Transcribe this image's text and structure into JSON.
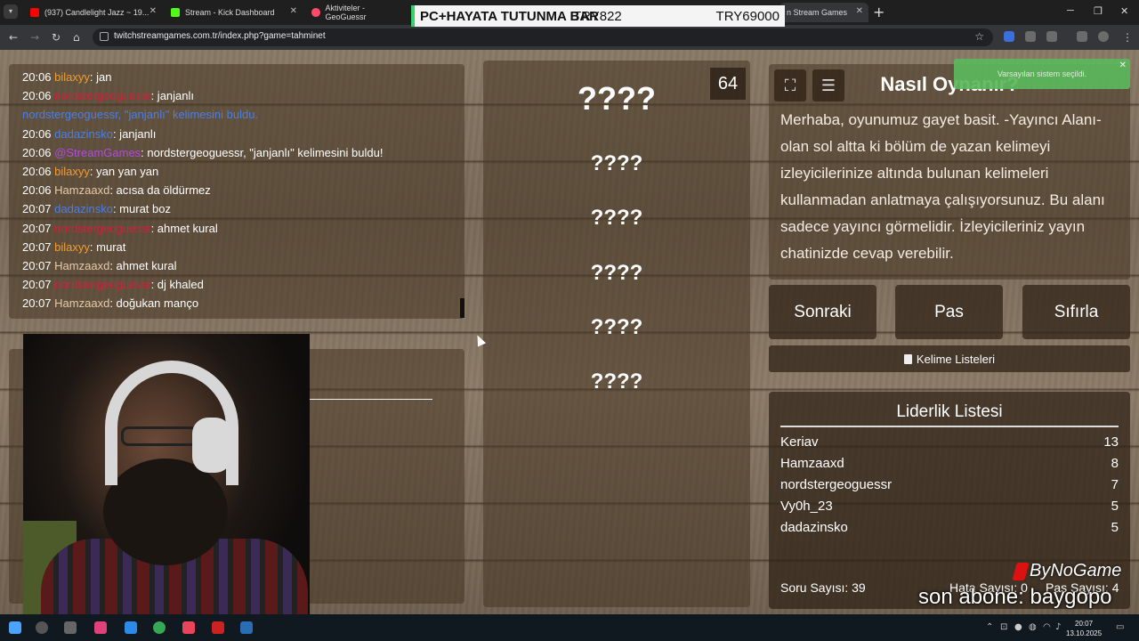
{
  "browser": {
    "tabs": [
      {
        "title": "(937) Candlelight Jazz ~ 19...",
        "color": "#ff0000"
      },
      {
        "title": "Stream - Kick Dashboard",
        "color": "#53fc18"
      },
      {
        "title": "Aktiviteler - GeoGuessr",
        "color": "#ff4a6a"
      },
      {
        "title": "n Stream Games",
        "color": "#6b6bff"
      }
    ],
    "url": "twitchstreamgames.com.tr/index.php?game=tahminet"
  },
  "overlay": {
    "left": "PC+HAYATA TUTUNMA BAR",
    "mid": "TRY822",
    "right": "TRY69000"
  },
  "chat": [
    {
      "time": "20:06",
      "user": "bilaxyy",
      "cls": "u-orange",
      "msg": ": jan"
    },
    {
      "time": "20:06",
      "user": "nordstergeoguessr",
      "cls": "u-red",
      "msg": ": janjanlı"
    },
    {
      "time": "",
      "user": "",
      "cls": "sys",
      "msg": "nordstergeoguessr, \"janjanlı\" kelimesini buldu."
    },
    {
      "time": "20:06",
      "user": "dadazinsko",
      "cls": "u-blue",
      "msg": ": janjanlı"
    },
    {
      "time": "20:06",
      "user": "@StreamGames",
      "cls": "u-purple",
      "msg": ": nordstergeoguessr, \"janjanlı\" kelimesini buldu!"
    },
    {
      "time": "20:06",
      "user": "bilaxyy",
      "cls": "u-orange",
      "msg": ": yan yan yan"
    },
    {
      "time": "20:06",
      "user": "Hamzaaxd",
      "cls": "u-tan",
      "msg": ": acısa da öldürmez"
    },
    {
      "time": "20:07",
      "user": "dadazinsko",
      "cls": "u-blue",
      "msg": ": murat boz"
    },
    {
      "time": "20:07",
      "user": "nordstergeoguessr",
      "cls": "u-red",
      "msg": ": ahmet kural"
    },
    {
      "time": "20:07",
      "user": "bilaxyy",
      "cls": "u-orange",
      "msg": ": murat"
    },
    {
      "time": "20:07",
      "user": "Hamzaaxd",
      "cls": "u-tan",
      "msg": ": ahmet kural"
    },
    {
      "time": "20:07",
      "user": "nordstergeoguessr",
      "cls": "u-red",
      "msg": ": dj khaled"
    },
    {
      "time": "20:07",
      "user": "Hamzaaxd",
      "cls": "u-tan",
      "msg": ": doğukan manço"
    }
  ],
  "game": {
    "counter": "64",
    "words": [
      "????",
      "????",
      "????",
      "????",
      "????",
      "????"
    ]
  },
  "howto": {
    "title": "Nasıl Oynanır?",
    "text": "Merhaba, oyunumuz gayet basit. -Yayıncı Alanı- olan sol altta ki bölüm de yazan kelimeyi izleyicilerinize altında bulunan kelimeleri kullanmadan anlatmaya çalışıyorsunuz. Bu alanı sadece yayıncı görmelidir. İzleyicileriniz yayın chatinizde cevap verebilir."
  },
  "buttons": {
    "next": "Sonraki",
    "pass": "Pas",
    "reset": "Sıfırla",
    "wordlists": "Kelime Listeleri"
  },
  "toast": "Varsayılan sistem seçildi.",
  "leaderboard": {
    "title": "Liderlik Listesi",
    "rows": [
      {
        "name": "Keriav",
        "score": "13"
      },
      {
        "name": "Hamzaaxd",
        "score": "8"
      },
      {
        "name": "nordstergeoguessr",
        "score": "7"
      },
      {
        "name": "Vy0h_23",
        "score": "5"
      },
      {
        "name": "dadazinsko",
        "score": "5"
      }
    ]
  },
  "stats": {
    "questions": "Soru Sayısı: 39",
    "errors": "Hata Sayısı: 0",
    "passes": "Pas Sayısı: 4"
  },
  "stream_overlay": {
    "brand": "ByNoGame",
    "last_sub": "son abone: baygopo"
  },
  "taskbar": {
    "time": "20:07",
    "date": "13.10.2025"
  }
}
